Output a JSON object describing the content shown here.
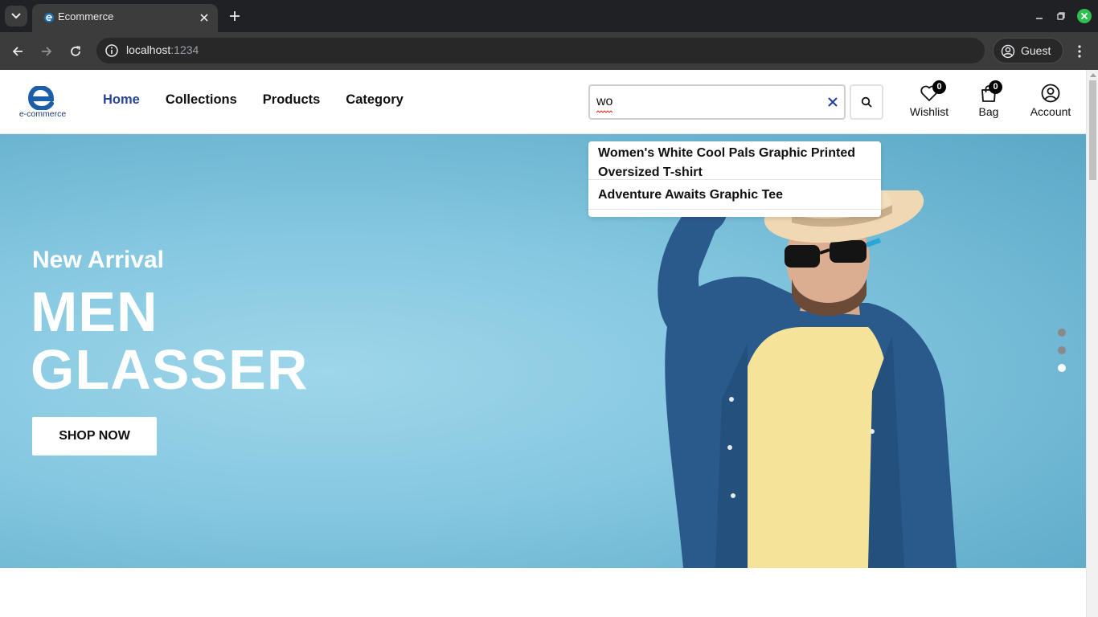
{
  "browser": {
    "tab_title": "Ecommerce",
    "url_host": "localhost",
    "url_port": ":1234",
    "profile_label": "Guest"
  },
  "site": {
    "logo_text": "e-commerce",
    "nav": [
      {
        "label": "Home",
        "active": true
      },
      {
        "label": "Collections",
        "active": false
      },
      {
        "label": "Products",
        "active": false
      },
      {
        "label": "Category",
        "active": false
      }
    ],
    "search": {
      "value": "wo"
    },
    "actions": {
      "wishlist_label": "Wishlist",
      "wishlist_count": "0",
      "bag_label": "Bag",
      "bag_count": "0",
      "account_label": "Account"
    },
    "suggestions": [
      "Women's White Cool Pals Graphic Printed Oversized T-shirt",
      "Adventure Awaits Graphic Tee"
    ],
    "hero": {
      "eyebrow": "New Arrival",
      "title": "MEN GLASSER",
      "cta": "SHOP NOW",
      "active_slide": 3,
      "slide_count": 3
    }
  },
  "colors": {
    "accent_nav": "#27449a",
    "hero_bg": "#86c8e0"
  }
}
